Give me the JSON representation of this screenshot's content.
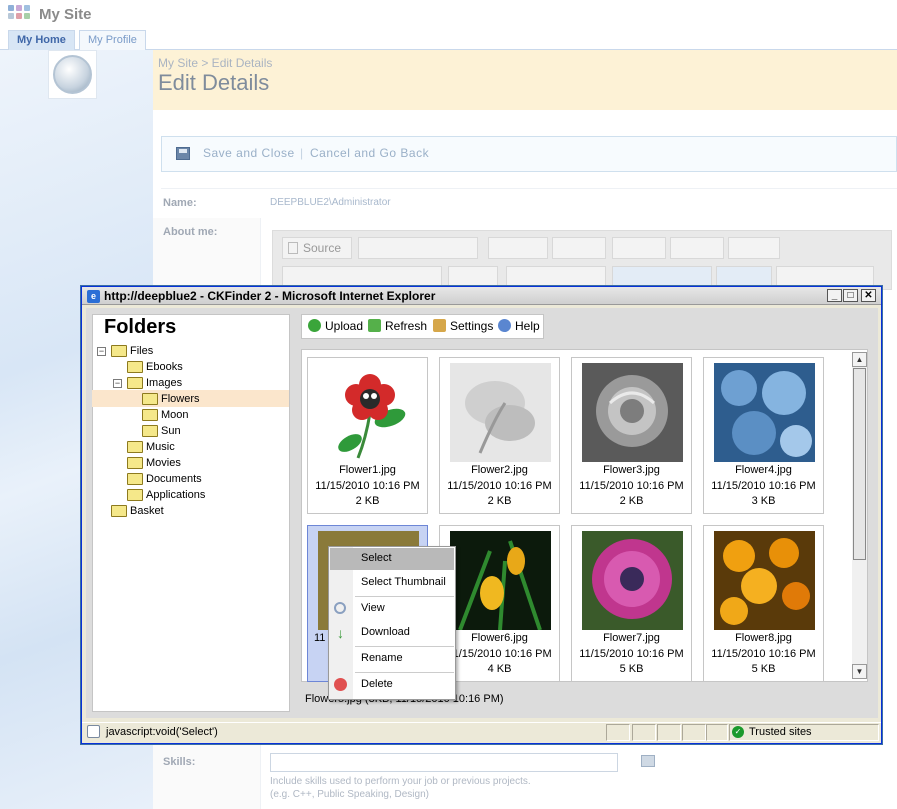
{
  "site": {
    "title": "My Site"
  },
  "nav": {
    "tabs": [
      {
        "label": "My Home"
      },
      {
        "label": "My Profile"
      }
    ]
  },
  "page": {
    "breadcrumb": "My Site > Edit Details",
    "title": "Edit Details"
  },
  "toolbar": {
    "save_label": "Save and Close",
    "separator": "|",
    "cancel_label": "Cancel and Go Back"
  },
  "form": {
    "name_label": "Name:",
    "name_value": "DEEPBLUE2\\Administrator",
    "about_label": "About me:",
    "skills_label": "Skills:",
    "skills_hint_1": "Include skills used to perform your job or previous projects.",
    "skills_hint_2": "(e.g. C++, Public Speaking, Design)"
  },
  "editor": {
    "source_label": "Source"
  },
  "ie": {
    "title": "http://deepblue2 - CKFinder 2 - Microsoft Internet Explorer",
    "status_text": "javascript:void('Select')",
    "zone_text": "Trusted sites"
  },
  "ckfinder": {
    "folders_title": "Folders",
    "tree": [
      "Files",
      "Ebooks",
      "Images",
      "Flowers",
      "Moon",
      "Sun",
      "Music",
      "Movies",
      "Documents",
      "Applications",
      "Basket"
    ],
    "tools": [
      {
        "label": "Upload"
      },
      {
        "label": "Refresh"
      },
      {
        "label": "Settings"
      },
      {
        "label": "Help"
      }
    ],
    "files": [
      {
        "name": "Flower1.jpg",
        "date": "11/15/2010 10:16 PM",
        "size": "2 KB"
      },
      {
        "name": "Flower2.jpg",
        "date": "11/15/2010 10:16 PM",
        "size": "2 KB"
      },
      {
        "name": "Flower3.jpg",
        "date": "11/15/2010 10:16 PM",
        "size": "2 KB"
      },
      {
        "name": "Flower4.jpg",
        "date": "11/15/2010 10:16 PM",
        "size": "3 KB"
      },
      {
        "name": "11",
        "date": "",
        "size": ""
      },
      {
        "name": "Flower6.jpg",
        "date": "11/15/2010 10:16 PM",
        "size": "4 KB"
      },
      {
        "name": "Flower7.jpg",
        "date": "11/15/2010 10:16 PM",
        "size": "5 KB"
      },
      {
        "name": "Flower8.jpg",
        "date": "11/15/2010 10:16 PM",
        "size": "5 KB"
      }
    ],
    "status": "Flower5.jpg (3KB, 11/15/2010 10:16 PM)",
    "context_menu": [
      "Select",
      "Select Thumbnail",
      "View",
      "Download",
      "Rename",
      "Delete"
    ]
  },
  "colors": {
    "header_bg": "#fdf2d6",
    "ie_frame": "#0831d9",
    "selected_thumb": "#c7d3f3",
    "menu_highlight": "#b9b9b9"
  }
}
